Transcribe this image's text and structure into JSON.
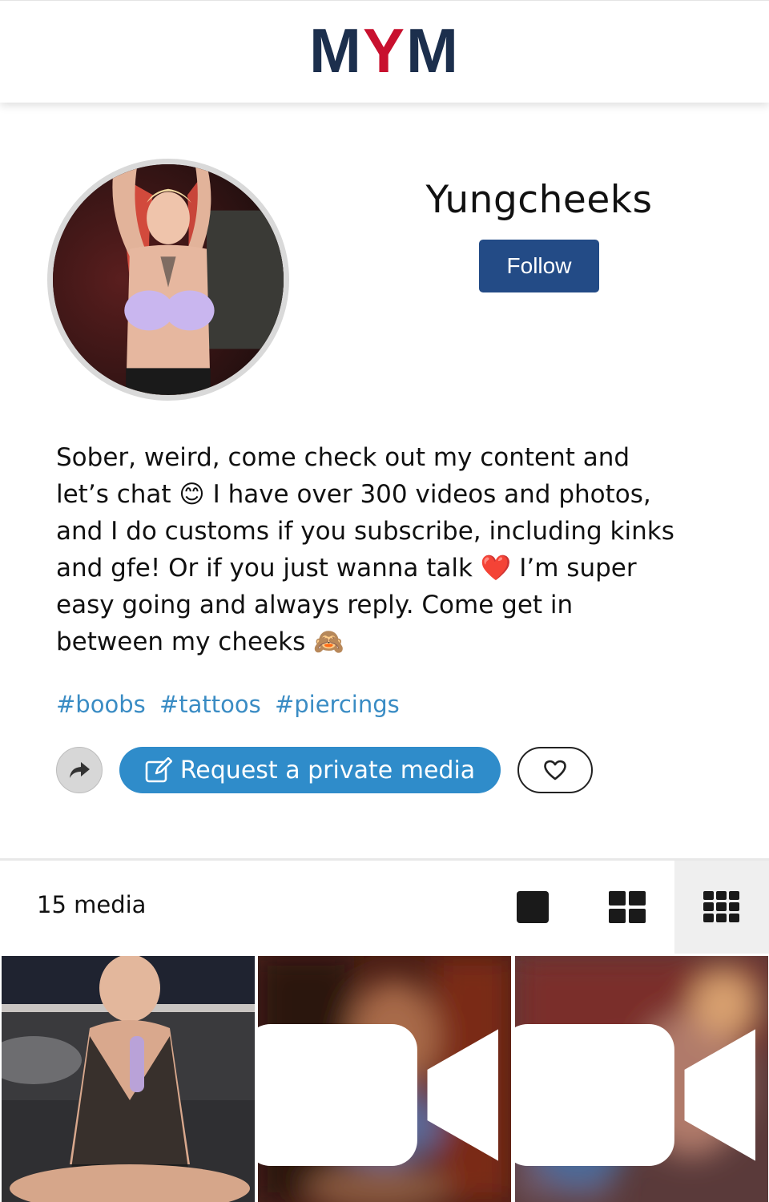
{
  "header": {
    "logo_left": "M",
    "logo_mid": "Y",
    "logo_right": "M"
  },
  "profile": {
    "username": "Yungcheeks",
    "follow_label": "Follow",
    "bio_lines": [
      "Sober, weird, come check out my content and",
      "let’s chat 😊 I have over 300 videos and photos,",
      "and I do customs if you subscribe, including kinks",
      "and gfe! Or if you just wanna talk ❤️ I’m super",
      "easy going and always reply. Come get in",
      "between my cheeks 🙈"
    ],
    "tags": [
      "#boobs",
      "#tattoos",
      "#piercings"
    ],
    "request_label": "Request a private media",
    "share_icon": "share-arrow-icon",
    "like_icon": "heart-outline-icon"
  },
  "media": {
    "count_label": "15 media",
    "views": [
      "single-view-icon",
      "two-column-view-icon",
      "three-column-view-icon"
    ],
    "selected_view": "three-column-view-icon",
    "tiles": [
      {
        "type": "photo"
      },
      {
        "type": "video",
        "icon": "video-camera-icon"
      },
      {
        "type": "video",
        "icon": "video-camera-icon"
      }
    ]
  },
  "colors": {
    "brand_navy": "#1c2f4d",
    "brand_red": "#c8102e",
    "follow_bg": "#234b86",
    "request_bg": "#2f8cca",
    "tag_color": "#3a8cc4"
  }
}
